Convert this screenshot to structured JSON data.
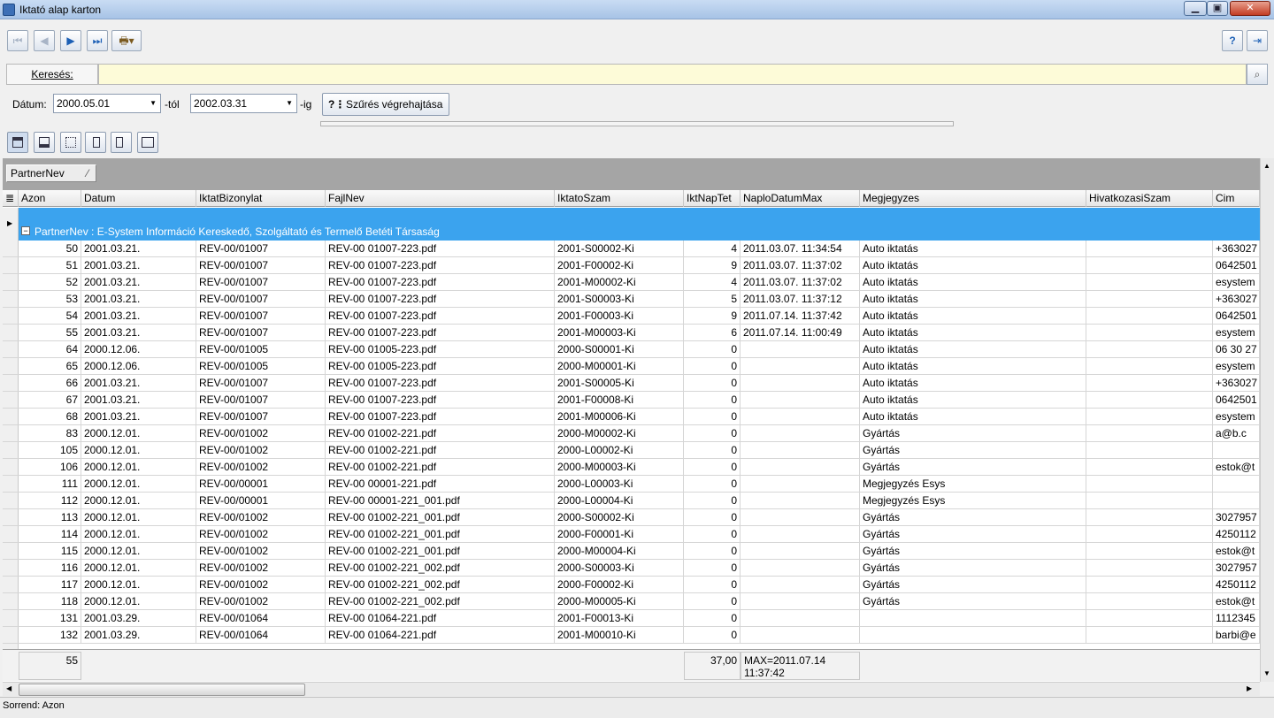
{
  "window": {
    "title": "Iktató alap karton"
  },
  "search": {
    "label": "Keresés:",
    "value": ""
  },
  "filter": {
    "date_label": "Dátum:",
    "from_value": "2000.05.01",
    "from_suffix": "-tól",
    "to_value": "2002.03.31",
    "to_suffix": "-ig",
    "apply_label": "Szűrés végrehajtása"
  },
  "groupby": {
    "chip": "PartnerNev"
  },
  "grid": {
    "columns": [
      "Azon",
      "Datum",
      "IktatBizonylat",
      "FajlNev",
      "IktatoSzam",
      "IktNapTet",
      "NaploDatumMax",
      "Megjegyzes",
      "HivatkozasiSzam",
      "Cim"
    ],
    "group_label": "PartnerNev : E-System Információ Kereskedő, Szolgáltató és Termelő Betéti Társaság",
    "rows": [
      [
        "50",
        "2001.03.21.",
        "REV-00/01007",
        "REV-00 01007-223.pdf",
        "2001-S00002-Ki",
        "4",
        "2011.03.07. 11:34:54",
        "Auto iktatás",
        "",
        "+363027"
      ],
      [
        "51",
        "2001.03.21.",
        "REV-00/01007",
        "REV-00 01007-223.pdf",
        "2001-F00002-Ki",
        "9",
        "2011.03.07. 11:37:02",
        "Auto iktatás",
        "",
        "0642501"
      ],
      [
        "52",
        "2001.03.21.",
        "REV-00/01007",
        "REV-00 01007-223.pdf",
        "2001-M00002-Ki",
        "4",
        "2011.03.07. 11:37:02",
        "Auto iktatás",
        "",
        "esystem"
      ],
      [
        "53",
        "2001.03.21.",
        "REV-00/01007",
        "REV-00 01007-223.pdf",
        "2001-S00003-Ki",
        "5",
        "2011.03.07. 11:37:12",
        "Auto iktatás",
        "",
        "+363027"
      ],
      [
        "54",
        "2001.03.21.",
        "REV-00/01007",
        "REV-00 01007-223.pdf",
        "2001-F00003-Ki",
        "9",
        "2011.07.14. 11:37:42",
        "Auto iktatás",
        "",
        "0642501"
      ],
      [
        "55",
        "2001.03.21.",
        "REV-00/01007",
        "REV-00 01007-223.pdf",
        "2001-M00003-Ki",
        "6",
        "2011.07.14. 11:00:49",
        "Auto iktatás",
        "",
        "esystem"
      ],
      [
        "64",
        "2000.12.06.",
        "REV-00/01005",
        "REV-00 01005-223.pdf",
        "2000-S00001-Ki",
        "0",
        "",
        "Auto iktatás",
        "",
        "06 30 27"
      ],
      [
        "65",
        "2000.12.06.",
        "REV-00/01005",
        "REV-00 01005-223.pdf",
        "2000-M00001-Ki",
        "0",
        "",
        "Auto iktatás",
        "",
        "esystem"
      ],
      [
        "66",
        "2001.03.21.",
        "REV-00/01007",
        "REV-00 01007-223.pdf",
        "2001-S00005-Ki",
        "0",
        "",
        "Auto iktatás",
        "",
        "+363027"
      ],
      [
        "67",
        "2001.03.21.",
        "REV-00/01007",
        "REV-00 01007-223.pdf",
        "2001-F00008-Ki",
        "0",
        "",
        "Auto iktatás",
        "",
        "0642501"
      ],
      [
        "68",
        "2001.03.21.",
        "REV-00/01007",
        "REV-00 01007-223.pdf",
        "2001-M00006-Ki",
        "0",
        "",
        "Auto iktatás",
        "",
        "esystem"
      ],
      [
        "83",
        "2000.12.01.",
        "REV-00/01002",
        "REV-00 01002-221.pdf",
        "2000-M00002-Ki",
        "0",
        "",
        "Gyártás",
        "",
        "a@b.c"
      ],
      [
        "105",
        "2000.12.01.",
        "REV-00/01002",
        "REV-00 01002-221.pdf",
        "2000-L00002-Ki",
        "0",
        "",
        "Gyártás",
        "",
        ""
      ],
      [
        "106",
        "2000.12.01.",
        "REV-00/01002",
        "REV-00 01002-221.pdf",
        "2000-M00003-Ki",
        "0",
        "",
        "Gyártás",
        "",
        "estok@t"
      ],
      [
        "111",
        "2000.12.01.",
        "REV-00/00001",
        "REV-00 00001-221.pdf",
        "2000-L00003-Ki",
        "0",
        "",
        "Megjegyzés Esys",
        "",
        ""
      ],
      [
        "112",
        "2000.12.01.",
        "REV-00/00001",
        "REV-00 00001-221_001.pdf",
        "2000-L00004-Ki",
        "0",
        "",
        "Megjegyzés Esys",
        "",
        ""
      ],
      [
        "113",
        "2000.12.01.",
        "REV-00/01002",
        "REV-00 01002-221_001.pdf",
        "2000-S00002-Ki",
        "0",
        "",
        "Gyártás",
        "",
        "3027957"
      ],
      [
        "114",
        "2000.12.01.",
        "REV-00/01002",
        "REV-00 01002-221_001.pdf",
        "2000-F00001-Ki",
        "0",
        "",
        "Gyártás",
        "",
        "4250112"
      ],
      [
        "115",
        "2000.12.01.",
        "REV-00/01002",
        "REV-00 01002-221_001.pdf",
        "2000-M00004-Ki",
        "0",
        "",
        "Gyártás",
        "",
        "estok@t"
      ],
      [
        "116",
        "2000.12.01.",
        "REV-00/01002",
        "REV-00 01002-221_002.pdf",
        "2000-S00003-Ki",
        "0",
        "",
        "Gyártás",
        "",
        "3027957"
      ],
      [
        "117",
        "2000.12.01.",
        "REV-00/01002",
        "REV-00 01002-221_002.pdf",
        "2000-F00002-Ki",
        "0",
        "",
        "Gyártás",
        "",
        "4250112"
      ],
      [
        "118",
        "2000.12.01.",
        "REV-00/01002",
        "REV-00 01002-221_002.pdf",
        "2000-M00005-Ki",
        "0",
        "",
        "Gyártás",
        "",
        "estok@t"
      ],
      [
        "131",
        "2001.03.29.",
        "REV-00/01064",
        "REV-00 01064-221.pdf",
        "2001-F00013-Ki",
        "0",
        "",
        "",
        "",
        "1112345"
      ],
      [
        "132",
        "2001.03.29.",
        "REV-00/01064",
        "REV-00 01064-221.pdf",
        "2001-M00010-Ki",
        "0",
        "",
        "",
        "",
        "barbi@e"
      ]
    ],
    "footer": {
      "count": "55",
      "sum": "37,00",
      "max_line1": "MAX=2011.07.14",
      "max_line2": "11:37:42"
    }
  },
  "status": {
    "text": "Sorrend: Azon"
  },
  "colors": {
    "group_row": "#3ba3ee",
    "search_bg": "#fdfbd8"
  }
}
